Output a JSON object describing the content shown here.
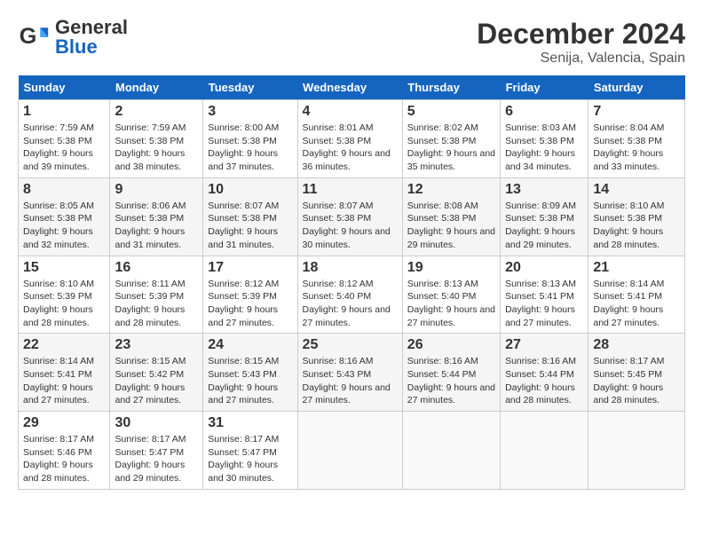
{
  "header": {
    "logo_text_regular": "General",
    "logo_text_blue": "Blue",
    "title": "December 2024",
    "subtitle": "Senija, Valencia, Spain"
  },
  "columns": [
    "Sunday",
    "Monday",
    "Tuesday",
    "Wednesday",
    "Thursday",
    "Friday",
    "Saturday"
  ],
  "weeks": [
    [
      {
        "day": "1",
        "info": "Sunrise: 7:59 AM\nSunset: 5:38 PM\nDaylight: 9 hours and 39 minutes."
      },
      {
        "day": "2",
        "info": "Sunrise: 7:59 AM\nSunset: 5:38 PM\nDaylight: 9 hours and 38 minutes."
      },
      {
        "day": "3",
        "info": "Sunrise: 8:00 AM\nSunset: 5:38 PM\nDaylight: 9 hours and 37 minutes."
      },
      {
        "day": "4",
        "info": "Sunrise: 8:01 AM\nSunset: 5:38 PM\nDaylight: 9 hours and 36 minutes."
      },
      {
        "day": "5",
        "info": "Sunrise: 8:02 AM\nSunset: 5:38 PM\nDaylight: 9 hours and 35 minutes."
      },
      {
        "day": "6",
        "info": "Sunrise: 8:03 AM\nSunset: 5:38 PM\nDaylight: 9 hours and 34 minutes."
      },
      {
        "day": "7",
        "info": "Sunrise: 8:04 AM\nSunset: 5:38 PM\nDaylight: 9 hours and 33 minutes."
      }
    ],
    [
      {
        "day": "8",
        "info": "Sunrise: 8:05 AM\nSunset: 5:38 PM\nDaylight: 9 hours and 32 minutes."
      },
      {
        "day": "9",
        "info": "Sunrise: 8:06 AM\nSunset: 5:38 PM\nDaylight: 9 hours and 31 minutes."
      },
      {
        "day": "10",
        "info": "Sunrise: 8:07 AM\nSunset: 5:38 PM\nDaylight: 9 hours and 31 minutes."
      },
      {
        "day": "11",
        "info": "Sunrise: 8:07 AM\nSunset: 5:38 PM\nDaylight: 9 hours and 30 minutes."
      },
      {
        "day": "12",
        "info": "Sunrise: 8:08 AM\nSunset: 5:38 PM\nDaylight: 9 hours and 29 minutes."
      },
      {
        "day": "13",
        "info": "Sunrise: 8:09 AM\nSunset: 5:38 PM\nDaylight: 9 hours and 29 minutes."
      },
      {
        "day": "14",
        "info": "Sunrise: 8:10 AM\nSunset: 5:38 PM\nDaylight: 9 hours and 28 minutes."
      }
    ],
    [
      {
        "day": "15",
        "info": "Sunrise: 8:10 AM\nSunset: 5:39 PM\nDaylight: 9 hours and 28 minutes."
      },
      {
        "day": "16",
        "info": "Sunrise: 8:11 AM\nSunset: 5:39 PM\nDaylight: 9 hours and 28 minutes."
      },
      {
        "day": "17",
        "info": "Sunrise: 8:12 AM\nSunset: 5:39 PM\nDaylight: 9 hours and 27 minutes."
      },
      {
        "day": "18",
        "info": "Sunrise: 8:12 AM\nSunset: 5:40 PM\nDaylight: 9 hours and 27 minutes."
      },
      {
        "day": "19",
        "info": "Sunrise: 8:13 AM\nSunset: 5:40 PM\nDaylight: 9 hours and 27 minutes."
      },
      {
        "day": "20",
        "info": "Sunrise: 8:13 AM\nSunset: 5:41 PM\nDaylight: 9 hours and 27 minutes."
      },
      {
        "day": "21",
        "info": "Sunrise: 8:14 AM\nSunset: 5:41 PM\nDaylight: 9 hours and 27 minutes."
      }
    ],
    [
      {
        "day": "22",
        "info": "Sunrise: 8:14 AM\nSunset: 5:41 PM\nDaylight: 9 hours and 27 minutes."
      },
      {
        "day": "23",
        "info": "Sunrise: 8:15 AM\nSunset: 5:42 PM\nDaylight: 9 hours and 27 minutes."
      },
      {
        "day": "24",
        "info": "Sunrise: 8:15 AM\nSunset: 5:43 PM\nDaylight: 9 hours and 27 minutes."
      },
      {
        "day": "25",
        "info": "Sunrise: 8:16 AM\nSunset: 5:43 PM\nDaylight: 9 hours and 27 minutes."
      },
      {
        "day": "26",
        "info": "Sunrise: 8:16 AM\nSunset: 5:44 PM\nDaylight: 9 hours and 27 minutes."
      },
      {
        "day": "27",
        "info": "Sunrise: 8:16 AM\nSunset: 5:44 PM\nDaylight: 9 hours and 28 minutes."
      },
      {
        "day": "28",
        "info": "Sunrise: 8:17 AM\nSunset: 5:45 PM\nDaylight: 9 hours and 28 minutes."
      }
    ],
    [
      {
        "day": "29",
        "info": "Sunrise: 8:17 AM\nSunset: 5:46 PM\nDaylight: 9 hours and 28 minutes."
      },
      {
        "day": "30",
        "info": "Sunrise: 8:17 AM\nSunset: 5:47 PM\nDaylight: 9 hours and 29 minutes."
      },
      {
        "day": "31",
        "info": "Sunrise: 8:17 AM\nSunset: 5:47 PM\nDaylight: 9 hours and 30 minutes."
      },
      null,
      null,
      null,
      null
    ]
  ]
}
